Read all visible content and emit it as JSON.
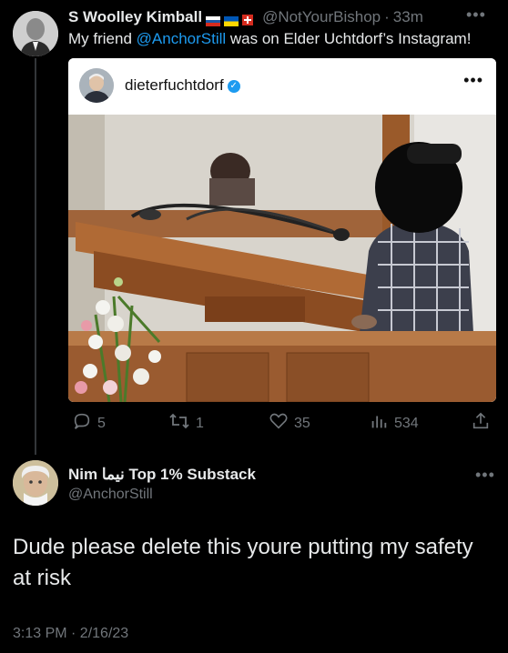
{
  "tweet1": {
    "display_name": "S Woolley Kimball",
    "handle": "@NotYourBishop",
    "separator": "·",
    "time": "33m",
    "text_before": "My friend ",
    "mention": "@AnchorStill",
    "text_after": " was on Elder Uchtdorf’s Instagram!",
    "flags": [
      "russia-flag",
      "ukraine-flag",
      "switzerland-flag"
    ]
  },
  "embed": {
    "username": "dieterfuchtdorf",
    "verified_icon": "verified-badge-icon",
    "more_icon": "more-horizontal-icon"
  },
  "actions": {
    "replies": "5",
    "retweets": "1",
    "likes": "35",
    "views": "534"
  },
  "tweet2": {
    "display_name": "Nim نیما Top 1% Substack",
    "handle": "@AnchorStill",
    "text": "Dude please delete this youre putting my safety at risk",
    "timestamp": "3:13 PM · 2/16/23"
  },
  "colors": {
    "background": "#000000",
    "text": "#e7e9ea",
    "muted": "#71767b",
    "link": "#1d9bf0"
  }
}
